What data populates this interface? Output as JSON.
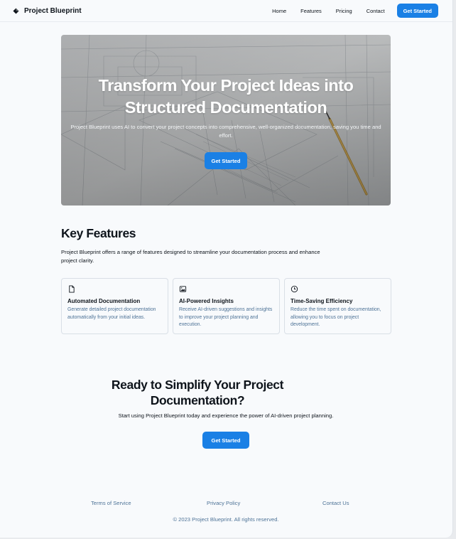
{
  "header": {
    "brand": "Project Blueprint",
    "nav": [
      "Home",
      "Features",
      "Pricing",
      "Contact"
    ],
    "cta_label": "Get Started"
  },
  "hero": {
    "title": "Transform Your Project Ideas into Structured Documentation",
    "subtitle": "Project Blueprint uses AI to convert your project concepts into comprehensive, well-organized documentation, saving you time and effort.",
    "cta_label": "Get Started"
  },
  "features": {
    "title": "Key Features",
    "description": "Project Blueprint offers a range of features designed to streamline your documentation process and enhance project clarity.",
    "cards": [
      {
        "icon": "document-icon",
        "title": "Automated Documentation",
        "description": "Generate detailed project documentation automatically from your initial ideas."
      },
      {
        "icon": "image-icon",
        "title": "AI-Powered Insights",
        "description": "Receive AI-driven suggestions and insights to improve your project planning and execution."
      },
      {
        "icon": "clock-icon",
        "title": "Time-Saving Efficiency",
        "description": "Reduce the time spent on documentation, allowing you to focus on project development."
      }
    ]
  },
  "cta": {
    "title": "Ready to Simplify Your Project Documentation?",
    "subtitle": "Start using Project Blueprint today and experience the power of AI-driven project planning.",
    "button_label": "Get Started"
  },
  "footer": {
    "links": [
      "Terms of Service",
      "Privacy Policy",
      "Contact Us"
    ],
    "copyright": "© 2023 Project Blueprint. All rights reserved."
  },
  "colors": {
    "accent": "#1a80e5",
    "text": "#0e141b",
    "muted": "#4e7397",
    "background": "#f8fafc"
  }
}
